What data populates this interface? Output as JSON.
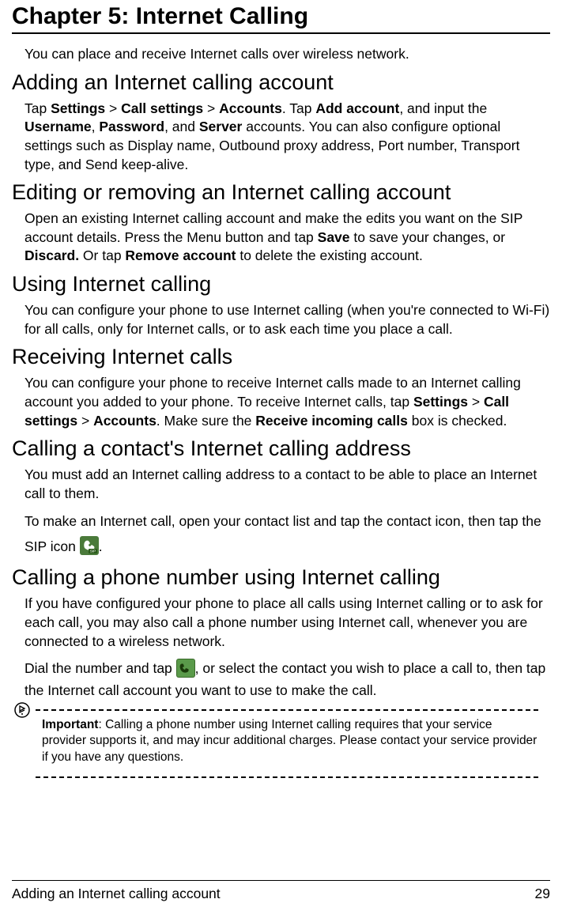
{
  "chapter_title": "Chapter 5: Internet Calling",
  "intro": "You can place and receive Internet calls over wireless network.",
  "sections": {
    "adding": {
      "heading": "Adding an Internet calling account",
      "p1_a": "Tap ",
      "p1_settings": "Settings",
      "p1_gt1": " > ",
      "p1_callsettings": "Call settings",
      "p1_gt2": " > ",
      "p1_accounts": "Accounts",
      "p1_b": ". Tap ",
      "p1_addaccount": "Add account",
      "p1_c": ", and input the ",
      "p1_username": "Username",
      "p1_comma1": ", ",
      "p1_password": "Password",
      "p1_d": ", and ",
      "p1_server": "Server",
      "p1_e": " accounts. You can also configure optional settings such as Display name, Outbound proxy address, Port number, Transport type, and Send keep-alive."
    },
    "editing": {
      "heading": "Editing or removing an Internet calling account",
      "p1_a": "Open an existing Internet calling account and make the edits you want on the SIP account details. Press the Menu button and tap ",
      "p1_save": "Save",
      "p1_b": " to save your changes, or ",
      "p1_discard": "Discard.",
      "p1_c": " Or tap ",
      "p1_remove": "Remove account",
      "p1_d": " to delete the existing account."
    },
    "using": {
      "heading": "Using Internet calling",
      "p1": "You can configure your phone to use Internet calling (when you're connected to Wi-Fi) for all calls, only for Internet calls, or to ask each time you place a call."
    },
    "receiving": {
      "heading": "Receiving Internet calls",
      "p1_a": "You can configure your phone to receive Internet calls made to an Internet calling account you added to your phone. To receive Internet calls, tap ",
      "p1_settings": "Settings",
      "p1_gt1": " > ",
      "p1_callsettings": "Call settings",
      "p1_gt2": " > ",
      "p1_accounts": "Accounts",
      "p1_b": ". Make sure the ",
      "p1_receive": "Receive incoming calls",
      "p1_c": " box is checked."
    },
    "callcontact": {
      "heading": "Calling a contact's Internet calling address",
      "p1": "You must add an Internet calling address to a contact to be able to place an Internet call to them.",
      "p2_a": "To make an Internet call, open your contact list and tap the contact icon, then tap the SIP icon ",
      "p2_b": "."
    },
    "callnumber": {
      "heading": "Calling a phone number using Internet calling",
      "p1": "If you have configured your phone to place all calls using Internet calling or to ask for each call, you may also call a phone number using Internet call, whenever you are connected to a wireless network.",
      "p2_a": "Dial the number and tap ",
      "p2_b": ", or select the contact you wish to place a call to, then tap the Internet call account you want to use to make the call."
    },
    "note": {
      "label": "Important",
      "text": ": Calling a phone number using Internet calling requires that your service provider supports it, and may incur additional charges. Please contact your service provider if you have any questions."
    }
  },
  "footer": {
    "left": "Adding an Internet calling account",
    "right": "29"
  }
}
